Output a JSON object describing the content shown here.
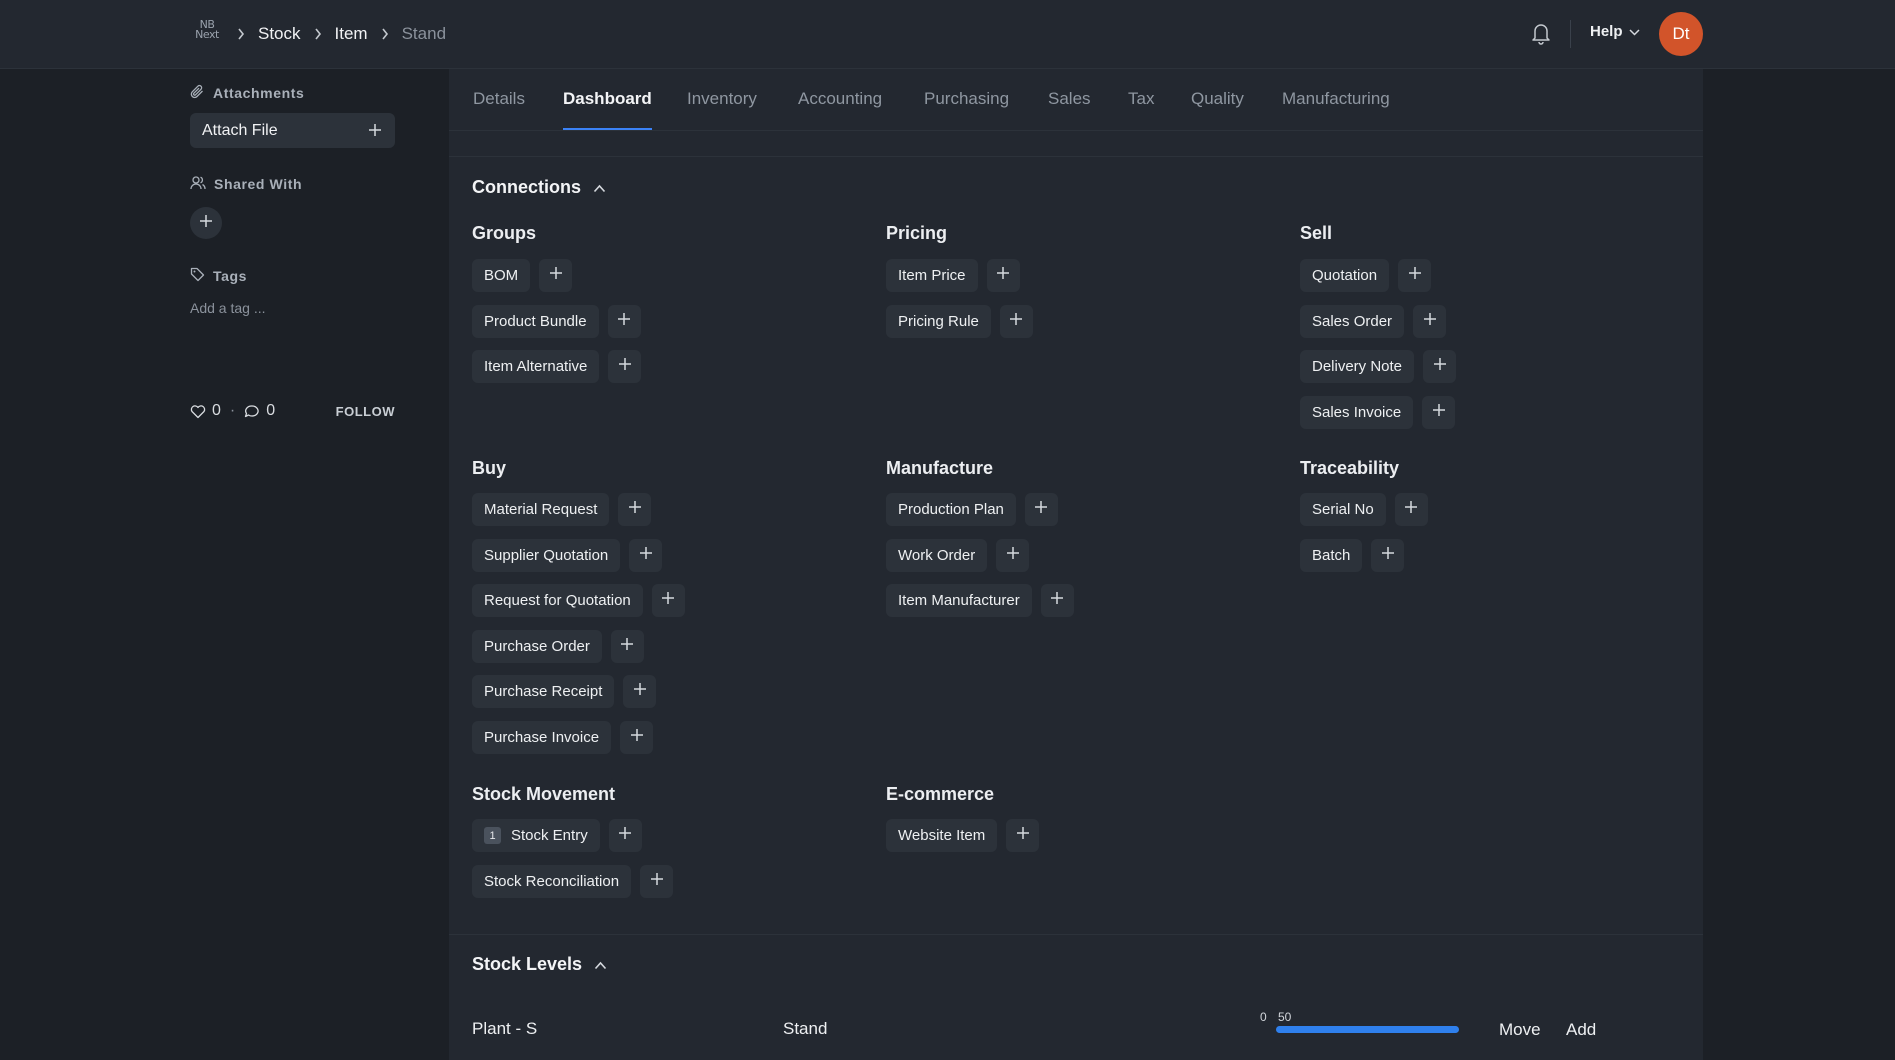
{
  "app": {
    "logo_text": "NB\nNext"
  },
  "breadcrumbs": [
    {
      "label": "Stock"
    },
    {
      "label": "Item"
    },
    {
      "label": "Stand"
    }
  ],
  "navbar": {
    "help_label": "Help",
    "avatar_initials": "Dt"
  },
  "sidebar": {
    "attachments_label": "Attachments",
    "attach_file_label": "Attach File",
    "shared_with_label": "Shared With",
    "tags_label": "Tags",
    "add_tag_placeholder": "Add a tag ...",
    "likes_count": "0",
    "comments_count": "0",
    "follow_label": "FOLLOW"
  },
  "tabs": [
    {
      "label": "Details"
    },
    {
      "label": "Dashboard"
    },
    {
      "label": "Inventory"
    },
    {
      "label": "Accounting"
    },
    {
      "label": "Purchasing"
    },
    {
      "label": "Sales"
    },
    {
      "label": "Tax"
    },
    {
      "label": "Quality"
    },
    {
      "label": "Manufacturing"
    }
  ],
  "active_tab": "Dashboard",
  "connections": {
    "title": "Connections",
    "groups": [
      {
        "title": "Groups",
        "items": [
          {
            "label": "BOM"
          },
          {
            "label": "Product Bundle"
          },
          {
            "label": "Item Alternative"
          }
        ]
      },
      {
        "title": "Pricing",
        "items": [
          {
            "label": "Item Price"
          },
          {
            "label": "Pricing Rule"
          }
        ]
      },
      {
        "title": "Sell",
        "items": [
          {
            "label": "Quotation"
          },
          {
            "label": "Sales Order"
          },
          {
            "label": "Delivery Note"
          },
          {
            "label": "Sales Invoice"
          }
        ]
      },
      {
        "title": "Buy",
        "items": [
          {
            "label": "Material Request"
          },
          {
            "label": "Supplier Quotation"
          },
          {
            "label": "Request for Quotation"
          },
          {
            "label": "Purchase Order"
          },
          {
            "label": "Purchase Receipt"
          },
          {
            "label": "Purchase Invoice"
          }
        ]
      },
      {
        "title": "Manufacture",
        "items": [
          {
            "label": "Production Plan"
          },
          {
            "label": "Work Order"
          },
          {
            "label": "Item Manufacturer"
          }
        ]
      },
      {
        "title": "Traceability",
        "items": [
          {
            "label": "Serial No"
          },
          {
            "label": "Batch"
          }
        ]
      },
      {
        "title": "Stock Movement",
        "items": [
          {
            "label": "Stock Entry",
            "count": "1"
          },
          {
            "label": "Stock Reconciliation"
          }
        ]
      },
      {
        "title": "E-commerce",
        "items": [
          {
            "label": "Website Item"
          }
        ]
      }
    ]
  },
  "stock_levels": {
    "title": "Stock Levels",
    "rows": [
      {
        "warehouse": "Plant - S",
        "item": "Stand",
        "bar_min_label": "0",
        "bar_value_label": "50",
        "fill_fraction": 1.0,
        "move_label": "Move",
        "add_label": "Add"
      }
    ]
  }
}
